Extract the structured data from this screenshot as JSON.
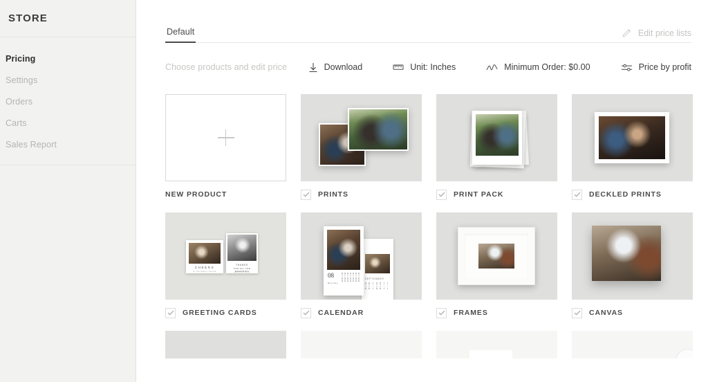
{
  "sidebar": {
    "brand": "STORE",
    "items": [
      {
        "label": "Pricing",
        "active": true
      },
      {
        "label": "Settings",
        "active": false
      },
      {
        "label": "Orders",
        "active": false
      },
      {
        "label": "Carts",
        "active": false
      },
      {
        "label": "Sales Report",
        "active": false
      }
    ]
  },
  "header": {
    "tabs": [
      {
        "label": "Default",
        "active": true
      }
    ],
    "edit_price_lists": "Edit price lists",
    "edit_icon": "pencil-icon"
  },
  "toolbar": {
    "hint": "Choose products and edit price",
    "actions": [
      {
        "label": "Download",
        "icon": "download-icon"
      },
      {
        "label": "Unit: Inches",
        "icon": "ruler-icon"
      },
      {
        "label": "Minimum Order: $0.00",
        "icon": "curve-icon"
      },
      {
        "label": "Price by profit",
        "icon": "sliders-icon"
      }
    ]
  },
  "products": {
    "new_product_label": "NEW PRODUCT",
    "items": [
      {
        "label": "PRINTS",
        "checked": true
      },
      {
        "label": "PRINT PACK",
        "checked": true
      },
      {
        "label": "DECKLED PRINTS",
        "checked": true
      },
      {
        "label": "GREETING CARDS",
        "checked": true
      },
      {
        "label": "CALENDAR",
        "checked": true
      },
      {
        "label": "FRAMES",
        "checked": true
      },
      {
        "label": "CANVAS",
        "checked": true
      }
    ],
    "greeting_card_text": {
      "front": "CHEERS",
      "front_sub": "to the happy couple",
      "back_line1": "THANKS",
      "back_line2": "FOR ALL THE MEMORIES",
      "back_sub": "see you soon"
    },
    "calendar_text": {
      "month_number": "08",
      "weekday_label": "Monday",
      "second_month": "SEPTEMBER"
    }
  },
  "colors": {
    "sidebar_bg": "#f2f2f1",
    "thumb_bg": "#dfdfdd",
    "text_dark": "#3d3d3d",
    "text_muted": "#c3c3c1",
    "tab_underline": "#4a4a4a"
  }
}
